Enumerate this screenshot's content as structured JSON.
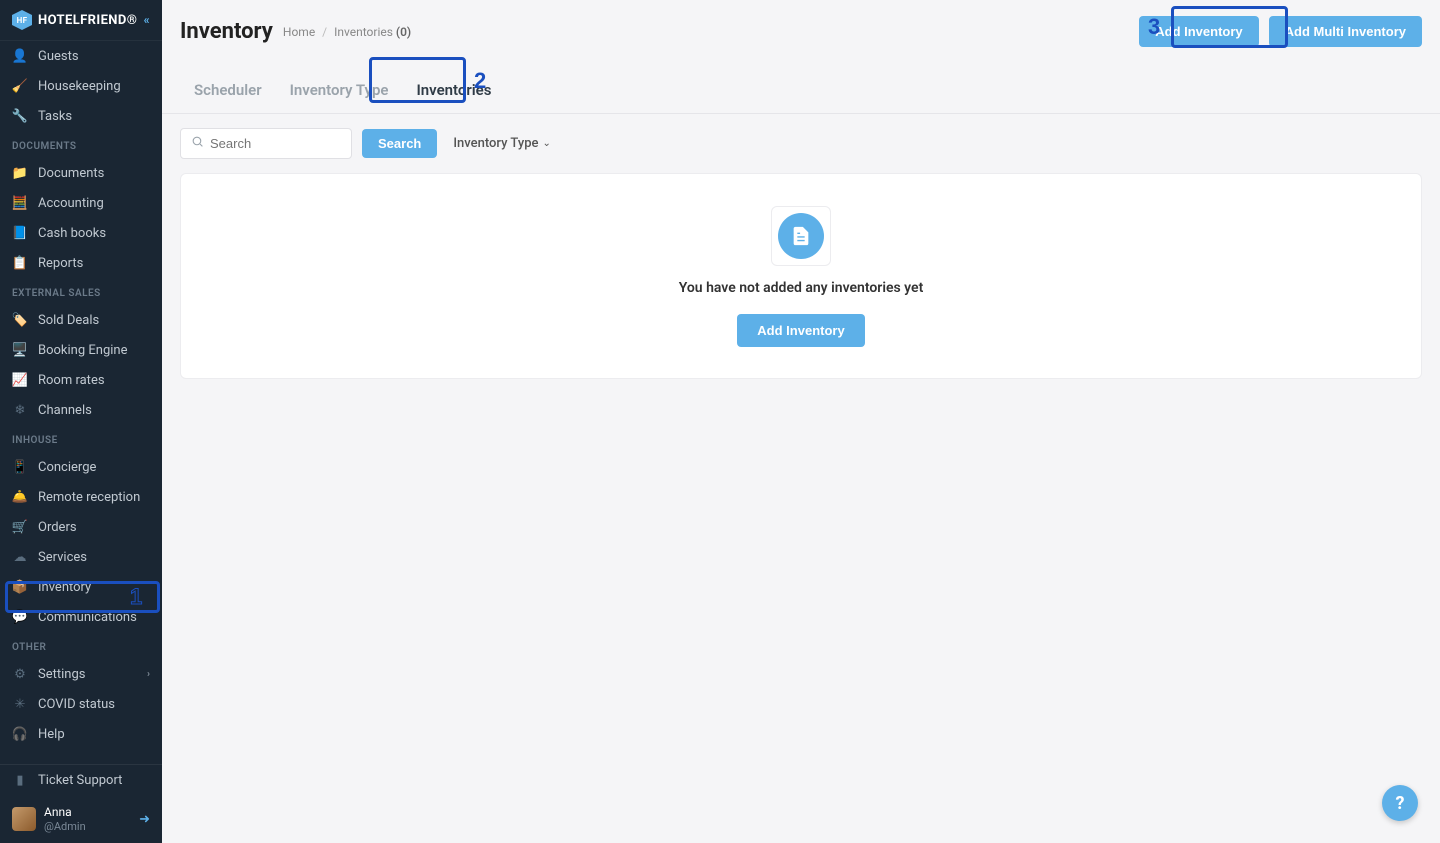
{
  "brand": "HOTELFRIEND®",
  "sidebar": {
    "top": [
      {
        "icon": "👤",
        "name": "guests",
        "label": "Guests"
      },
      {
        "icon": "🧹",
        "name": "housekeeping",
        "label": "Housekeeping"
      },
      {
        "icon": "🔧",
        "name": "tasks",
        "label": "Tasks"
      }
    ],
    "sections": [
      {
        "title": "DOCUMENTS",
        "items": [
          {
            "icon": "📁",
            "name": "documents",
            "label": "Documents"
          },
          {
            "icon": "🧮",
            "name": "accounting",
            "label": "Accounting"
          },
          {
            "icon": "📘",
            "name": "cash-books",
            "label": "Cash books"
          },
          {
            "icon": "📋",
            "name": "reports",
            "label": "Reports"
          }
        ]
      },
      {
        "title": "EXTERNAL SALES",
        "items": [
          {
            "icon": "🏷️",
            "name": "sold-deals",
            "label": "Sold Deals"
          },
          {
            "icon": "🖥️",
            "name": "booking-engine",
            "label": "Booking Engine"
          },
          {
            "icon": "📈",
            "name": "room-rates",
            "label": "Room rates"
          },
          {
            "icon": "❄",
            "name": "channels",
            "label": "Channels"
          }
        ]
      },
      {
        "title": "INHOUSE",
        "items": [
          {
            "icon": "📱",
            "name": "concierge",
            "label": "Concierge"
          },
          {
            "icon": "🛎️",
            "name": "remote-reception",
            "label": "Remote reception"
          },
          {
            "icon": "🛒",
            "name": "orders",
            "label": "Orders"
          },
          {
            "icon": "☁",
            "name": "services",
            "label": "Services"
          },
          {
            "icon": "📦",
            "name": "inventory",
            "label": "Inventory",
            "active": true
          },
          {
            "icon": "💬",
            "name": "communications",
            "label": "Communications"
          }
        ]
      },
      {
        "title": "OTHER",
        "items": [
          {
            "icon": "⚙",
            "name": "settings",
            "label": "Settings",
            "chevron": true
          },
          {
            "icon": "✳",
            "name": "covid-status",
            "label": "COVID status"
          },
          {
            "icon": "🎧",
            "name": "help",
            "label": "Help"
          }
        ]
      }
    ],
    "ticket": {
      "icon": "▮",
      "label": "Ticket Support"
    },
    "user": {
      "name": "Anna",
      "role": "@Admin"
    }
  },
  "header": {
    "title": "Inventory",
    "breadcrumb": {
      "home": "Home",
      "inventories": "Inventories",
      "count": "(0)"
    },
    "add_inventory": "Add Inventory",
    "add_multi": "Add Multi Inventory"
  },
  "tabs": {
    "scheduler": "Scheduler",
    "inventory_type": "Inventory Type",
    "inventories": "Inventories"
  },
  "toolbar": {
    "search_placeholder": "Search",
    "search_button": "Search",
    "filter_label": "Inventory Type"
  },
  "empty": {
    "message": "You have not added any inventories yet",
    "button": "Add Inventory"
  },
  "callouts": {
    "one": "1",
    "two": "2",
    "three": "3"
  },
  "help_fab": "?"
}
